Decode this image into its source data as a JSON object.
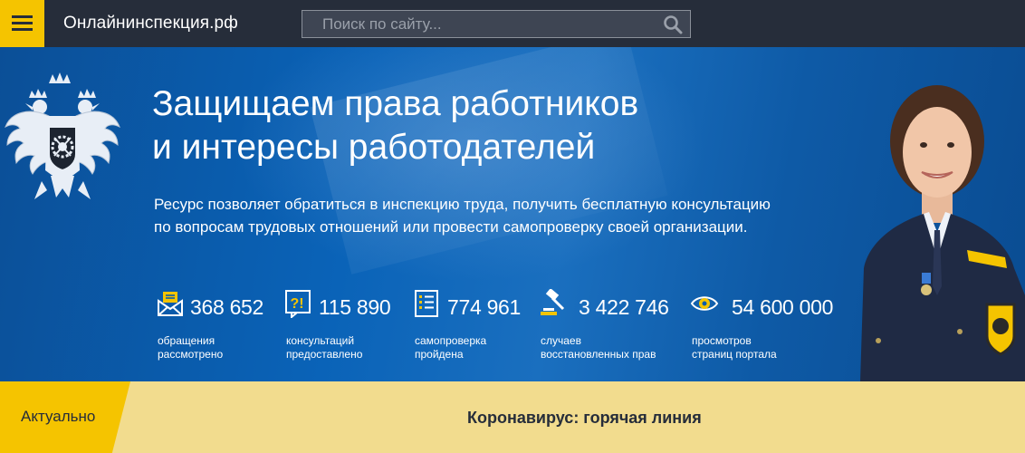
{
  "header": {
    "site_title": "Онлайнинспекция.рф",
    "search_placeholder": "Поиск по сайту..."
  },
  "hero": {
    "headline_line1": "Защищаем права работников",
    "headline_line2": "и интересы работодателей",
    "lead_line1": "Ресурс позволяет обратиться в инспекцию труда, получить бесплатную консультацию",
    "lead_line2": "по вопросам трудовых отношений или провести самопроверку своей организации."
  },
  "stats": [
    {
      "value": "368 652",
      "label_line1": "обращения",
      "label_line2": "рассмотрено",
      "icon": "envelope-icon"
    },
    {
      "value": "115 890",
      "label_line1": "консультаций",
      "label_line2": "предоставлено",
      "icon": "consultation-icon"
    },
    {
      "value": "774 961",
      "label_line1": "самопроверка",
      "label_line2": "пройдена",
      "icon": "checklist-icon"
    },
    {
      "value": "3 422 746",
      "label_line1": "случаев",
      "label_line2": "восстановленных прав",
      "icon": "gavel-icon"
    },
    {
      "value": "54 600 000",
      "label_line1": "просмотров",
      "label_line2": "страниц портала",
      "icon": "eye-icon"
    }
  ],
  "news": {
    "tab_label": "Актуально",
    "headline": "Коронавирус: горячая линия"
  },
  "colors": {
    "accent": "#f5c400",
    "header_bg": "#262d3a",
    "hero_bg": "#0a5ba8",
    "news_bg": "#f2dc8e"
  }
}
